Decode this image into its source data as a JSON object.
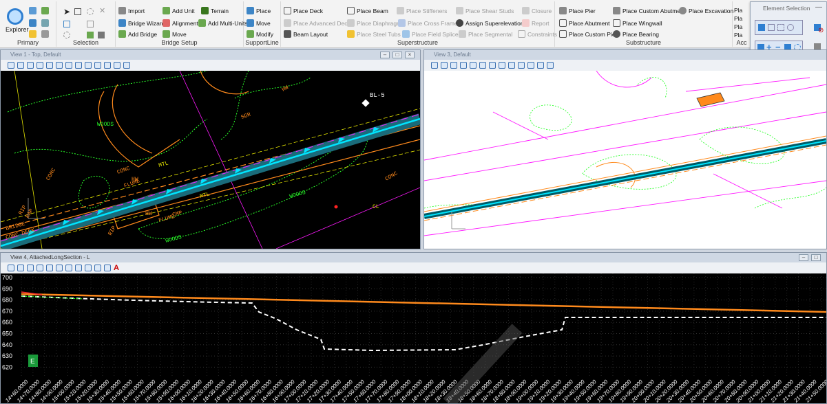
{
  "ribbon": {
    "explorer_label": "Explorer",
    "groups": {
      "primary": "Primary",
      "selection": "Selection",
      "bridge_setup": "Bridge Setup",
      "supportline": "SupportLine",
      "superstructure": "Superstructure",
      "substructure": "Substructure",
      "acc": "Acc"
    },
    "bridge_setup": {
      "import": "Import",
      "add_unit": "Add Unit",
      "terrain": "Terrain",
      "bridge_wizard": "Bridge Wizard",
      "alignment": "Alignment",
      "add_multi_units": "Add Multi-Units",
      "add_bridge": "Add Bridge",
      "move": "Move"
    },
    "supportline": {
      "place": "Place",
      "move": "Move",
      "modify": "Modify"
    },
    "superstructure": {
      "place_deck": "Place Deck",
      "place_advanced_deck": "Place Advanced Deck",
      "beam_layout": "Beam Layout",
      "place_beam": "Place Beam",
      "place_diaphragms": "Place Diaphragms",
      "place_steel_tubs": "Place Steel Tubs",
      "place_stiffeners": "Place Stiffeners",
      "place_cross_frames": "Place Cross Frames",
      "place_field_splices": "Place Field Splices",
      "place_shear_studs": "Place Shear Studs",
      "assign_superelevation": "Assign Superelevation",
      "place_segmental": "Place Segmental",
      "closure": "Closure",
      "report": "Report",
      "constraints": "Constraints"
    },
    "substructure": {
      "place_pier": "Place Pier",
      "place_abutment": "Place Abutment",
      "place_custom_pier": "Place Custom Pier",
      "place_custom_abutment": "Place Custom Abutment",
      "place_wingwall": "Place Wingwall",
      "place_bearing": "Place Bearing",
      "place_excavation": "Place Excavation"
    },
    "acc": {
      "pla1": "Pla",
      "pla2": "Pla",
      "pla3": "Pla",
      "pla4": "Pla"
    }
  },
  "element_selection": {
    "title": "Element Selection"
  },
  "views": {
    "view1": {
      "title": "View 1 - Top, Default",
      "labels": {
        "bl5": "BL-5",
        "conc1": "CONC",
        "conc2": "CONC",
        "conc3": "CONC",
        "conc_deck": "CONC DECK",
        "bridge": "BRIDGE",
        "woods1": "WOODS",
        "woods2": "WOODS",
        "woods3": "WOODS",
        "flume1": "FLUME",
        "flume2": "FLUME",
        "cmp": "CMP",
        "mtl1": "MTL",
        "mtl2": "MTL",
        "rip1": "RIP",
        "rip2": "RIP",
        "rap": "RAP",
        "hw1": "HW",
        "hw2": "HW",
        "hw3": "HW",
        "sgr": "SGR",
        "cl": "CL"
      }
    },
    "view3": {
      "title": "View 3, Default"
    },
    "view4": {
      "title": "View 4, AttachedLongSection - L",
      "y_ticks": [
        "700",
        "690",
        "680",
        "670",
        "660",
        "650",
        "640",
        "630",
        "620"
      ],
      "x_ticks": [
        "14+60.0000",
        "14+70.0000",
        "14+80.0000",
        "14+90.0000",
        "15+00.0000",
        "15+10.0000",
        "15+20.0000",
        "15+30.0000",
        "15+40.0000",
        "15+50.0000",
        "15+60.0000",
        "15+70.0000",
        "15+80.0000",
        "15+90.0000",
        "16+00.0000",
        "16+10.0000",
        "16+20.0000",
        "16+30.0000",
        "16+40.0000",
        "16+50.0000",
        "16+60.0000",
        "16+70.0000",
        "16+80.0000",
        "16+90.0000",
        "17+00.0000",
        "17+10.0000",
        "17+20.0000",
        "17+30.0000",
        "17+40.0000",
        "17+50.0000",
        "17+60.0000",
        "17+70.0000",
        "17+80.0000",
        "17+90.0000",
        "18+00.0000",
        "18+10.0000",
        "18+20.0000",
        "18+30.0000",
        "18+40.0000",
        "18+50.0000",
        "18+60.0000",
        "18+70.0000",
        "18+80.0000",
        "18+90.0000",
        "19+00.0000",
        "19+10.0000",
        "19+20.0000",
        "19+30.0000",
        "19+40.0000",
        "19+50.0000",
        "19+60.0000",
        "19+70.0000",
        "19+80.0000",
        "19+90.0000",
        "20+00.0000",
        "20+10.0000",
        "20+20.0000",
        "20+30.0000",
        "20+40.0000",
        "20+50.0000",
        "20+60.0000",
        "20+70.0000",
        "20+80.0000",
        "20+90.0000",
        "21+00.0000",
        "21+10.0000",
        "21+20.0000",
        "21+30.0000",
        "21+40.0000",
        "21+50.0000"
      ],
      "axis_marker": "E",
      "profile_color": "#ff8a1c",
      "ground_color": "#ffffff"
    }
  },
  "colors": {
    "ribbon_bg": "#f3f3f3",
    "accent": "#2f7fd1",
    "view_bg_dark": "#000000",
    "view_bg_light": "#ffffff",
    "alignment": "#00e5ff",
    "cad_green": "#29ff29",
    "cad_orange": "#ff8a1c",
    "cad_yellow": "#e6e600",
    "cad_magenta": "#ff19ff"
  }
}
